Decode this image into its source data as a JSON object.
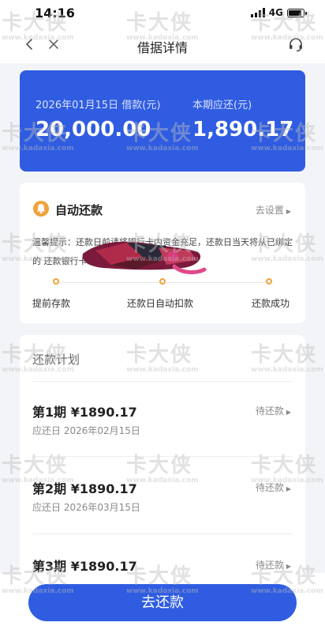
{
  "status_bar": {
    "time": "14:16",
    "network": "4G"
  },
  "nav": {
    "title": "借据详情",
    "back_icon": "chevron-left-icon",
    "close_icon": "close-icon",
    "service_icon": "headset-icon"
  },
  "loan_card": {
    "date_label": "2026年01月15日 借款(元)",
    "loan_amount": "20,000.00",
    "due_label": "本期应还(元)",
    "due_amount": "1,890.17",
    "color": "#2f5ce0"
  },
  "auto_repay": {
    "title": "自动还款",
    "setting": "去设置",
    "tip": "温馨提示：还款日前请将银行卡内资金充足，还款日当天将从已绑定的                                                                  还款银行卡发起自动扣款",
    "steps": [
      "提前存款",
      "还款日自动扣款",
      "还款成功"
    ],
    "accent": "#f0a23b"
  },
  "plan": {
    "title": "还款计划",
    "items": [
      {
        "title": "第1期 ¥1890.17",
        "date": "应还日 2026年02月15日",
        "status": "待还款"
      },
      {
        "title": "第2期 ¥1890.17",
        "date": "应还日 2026年03月15日",
        "status": "待还款"
      },
      {
        "title": "第3期 ¥1890.17",
        "date": "",
        "status": "待还款"
      }
    ]
  },
  "action": {
    "pay_label": "去还款"
  },
  "watermark": {
    "logo": "卡大侠",
    "url": "www.kadaxia.com"
  }
}
